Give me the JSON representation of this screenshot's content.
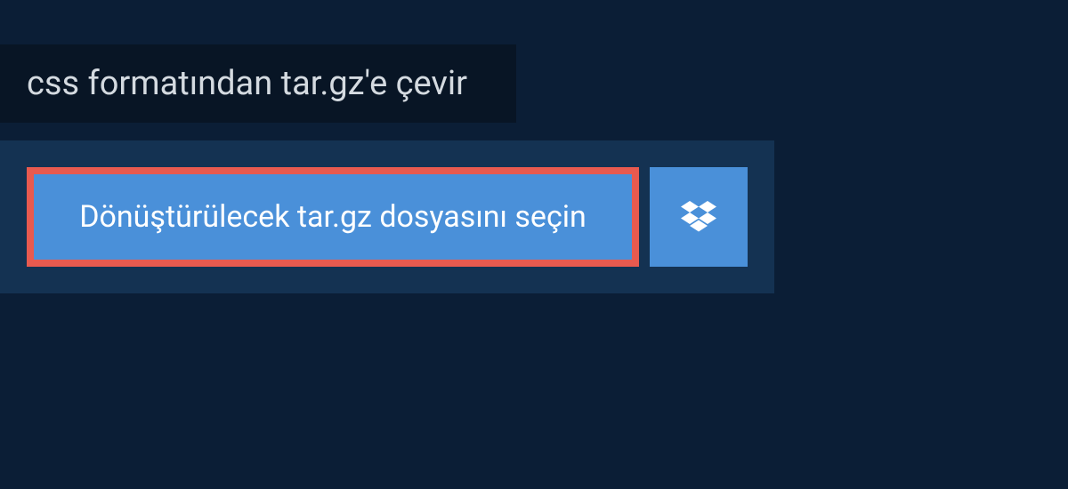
{
  "title": "css formatından tar.gz'e çevir",
  "buttons": {
    "select_file_label": "Dönüştürülecek tar.gz dosyasını seçin"
  },
  "colors": {
    "background": "#0b1e36",
    "title_bg": "#081525",
    "panel_bg": "#143252",
    "button_bg": "#4a90d9",
    "highlight_border": "#e85a4f",
    "text_light": "#ffffff",
    "text_title": "#d4dae0"
  }
}
